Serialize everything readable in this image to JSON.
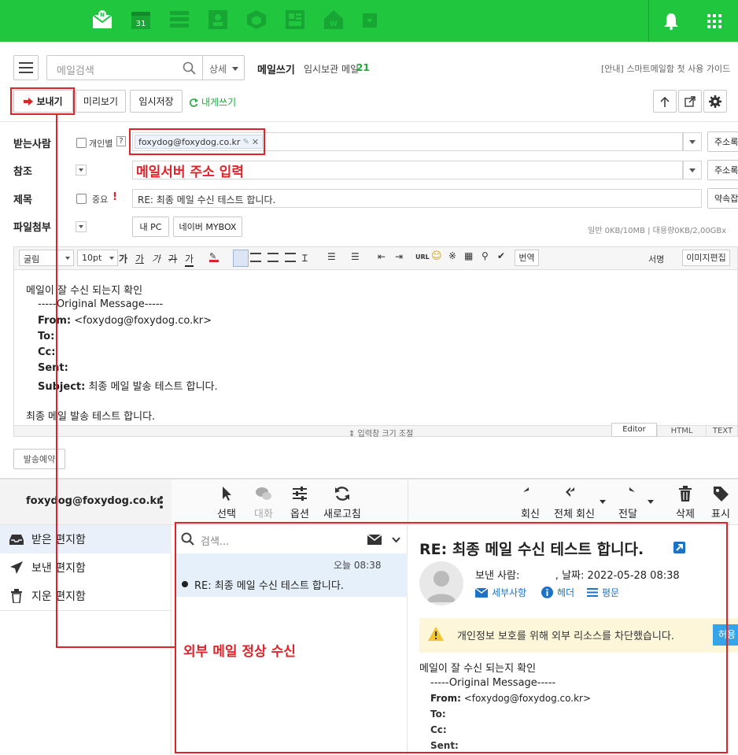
{
  "compose": {
    "search_placeholder": "메일검색",
    "search_detail": "상세",
    "title": "메일쓰기",
    "drafts_label": "임시보관 메일",
    "drafts_count": "21",
    "guide_link": "[안내] 스마트메일함 첫 사용 가이드",
    "send_button": "보내기",
    "preview_button": "미리보기",
    "save_draft_button": "임시저장",
    "send_to_me_button": "내게쓰기",
    "to_label": "받는사람",
    "individual_label": "개인별",
    "help_mark": "?",
    "recipient_chip": "foxydog@foxydog.co.kr",
    "address_book_button": "주소록",
    "cc_label": "참조",
    "subject_label": "제목",
    "important_label": "중요",
    "important_mark": "!",
    "subject_value": "RE: 최종 메일 수신 테스트 합니다.",
    "shorthand_button": "약속잡",
    "attach_label": "파일첨부",
    "my_pc_button": "내 PC",
    "mybox_button": "네이버 MYBOX",
    "quota_text": "일반 0KB/10MB  |  대용량0KB/2,00GBx",
    "font_select": "굴림",
    "size_select": "10pt",
    "translate_button": "번역",
    "signature_button": "서명",
    "image_edit_button": "이미지편집",
    "body_lines": [
      "메일이 잘 수신 되는지 확인",
      "-----Original Message-----",
      "<foxydog@foxydog.co.kr>",
      "최종 메일 발송 테스트 합니다.",
      "최종 메일 발송 테스트 합니다."
    ],
    "hdr_from": "From:",
    "hdr_to": "To:",
    "hdr_cc": "Cc:",
    "hdr_sent": "Sent:",
    "hdr_subject": "Subject:",
    "resize_hint": "⇕ 입력창 크기 조절",
    "mode_tabs": [
      "Editor",
      "HTML",
      "TEXT"
    ],
    "schedule_button": "발송예약"
  },
  "annotations": {
    "server_address": "메일서버 주소 입력",
    "external_ok": "외부 메일 정상 수신"
  },
  "client": {
    "account": "foxydog@foxydog.co.kr",
    "tools": [
      "선택",
      "대화",
      "옵션",
      "새로고침"
    ],
    "actions": [
      "회신",
      "전체 회신",
      "전달",
      "삭제",
      "표시"
    ],
    "folders": [
      "받은 편지함",
      "보낸 편지함",
      "지운 편지함"
    ],
    "search_placeholder": "검색...",
    "list_item": {
      "time": "오늘 08:38",
      "subject": "RE: 최종 메일 수신 테스트 합니다."
    },
    "reader": {
      "subject": "RE: 최종 메일 수신 테스트 합니다.",
      "sender_line": "보낸 사람:           , 날짜: 2022-05-28 08:38",
      "links": [
        "세부사항",
        "헤더",
        "평문"
      ],
      "privacy_notice": "개인정보 보호를 위해 외부 리소스를 차단했습니다.",
      "allow_button": "허용",
      "body_first": "메일이 잘 수신 되는지 확인",
      "body_original": "-----Original Message-----",
      "from_value": "<foxydog@foxydog.co.kr>"
    }
  },
  "colors": {
    "brand_green": "#20c63d",
    "accent_red": "#e0222a",
    "link_blue": "#1a73c9"
  }
}
